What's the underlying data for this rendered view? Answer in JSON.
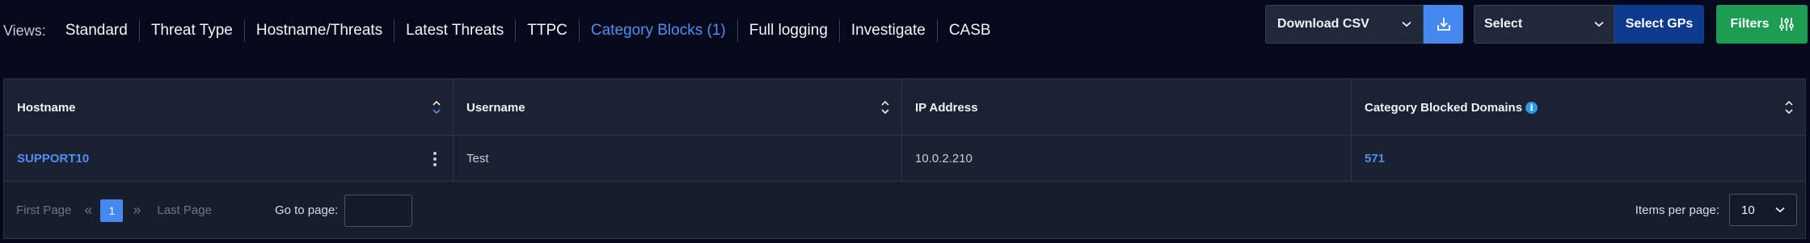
{
  "views": {
    "label": "Views:",
    "items": [
      {
        "label": "Standard"
      },
      {
        "label": "Threat Type"
      },
      {
        "label": "Hostname/Threats"
      },
      {
        "label": "Latest Threats"
      },
      {
        "label": "TTPC"
      },
      {
        "label": "Category Blocks (1)"
      },
      {
        "label": "Full logging"
      },
      {
        "label": "Investigate"
      },
      {
        "label": "CASB"
      }
    ],
    "active_index": 5
  },
  "toolbar": {
    "download_label": "Download CSV",
    "download_icon": "download-icon",
    "gp_select_value": "Select",
    "select_gps_label": "Select GPs",
    "filters_label": "Filters",
    "filters_icon": "sliders-icon"
  },
  "table": {
    "columns": [
      {
        "label": "Hostname"
      },
      {
        "label": "Username"
      },
      {
        "label": "IP Address"
      },
      {
        "label": "Category Blocked Domains"
      }
    ],
    "rows": [
      {
        "hostname": "SUPPORT10",
        "username": "Test",
        "ip": "10.0.2.210",
        "blocked": "571"
      }
    ]
  },
  "pagination": {
    "first_label": "First Page",
    "last_label": "Last Page",
    "current_page": "1",
    "goto_label": "Go to page:",
    "goto_value": "",
    "items_per_page_label": "Items per page:",
    "items_per_page_value": "10"
  },
  "colors": {
    "background": "#06091a",
    "accent_blue": "#4589f0",
    "link_blue": "#4f8ef7",
    "select_gps_bg": "#0e3a8e",
    "filters_green": "#1d9c53",
    "info_blue": "#2b9ae6"
  }
}
